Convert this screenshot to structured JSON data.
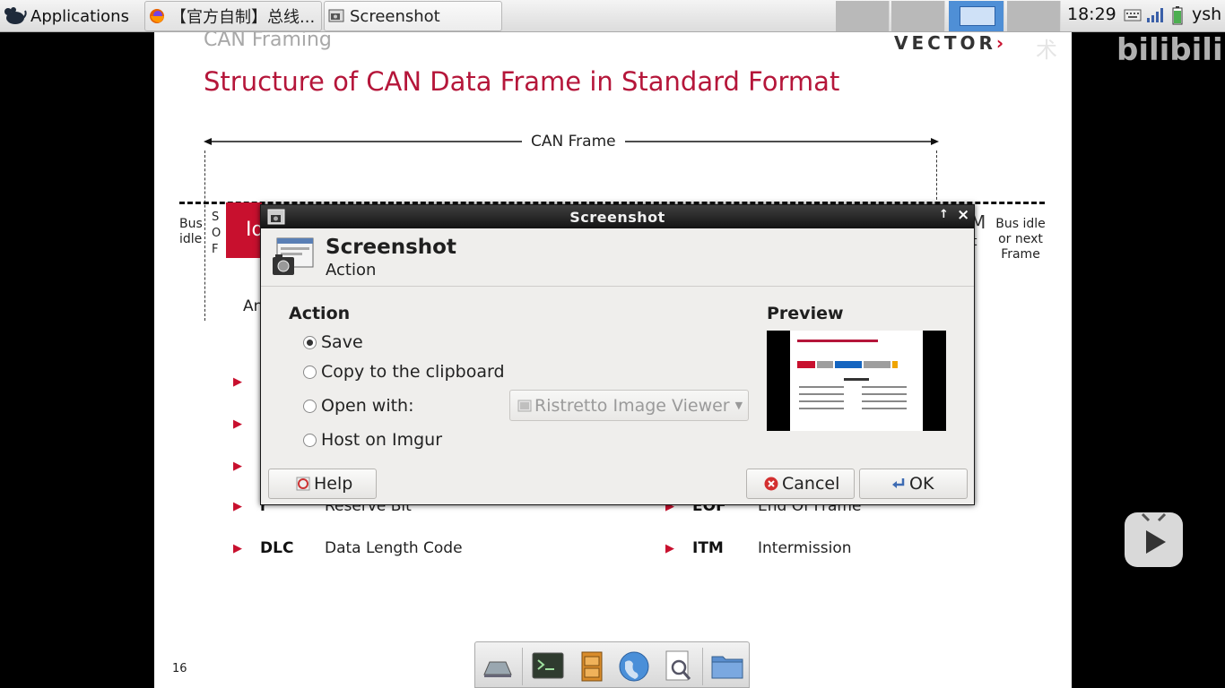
{
  "panel": {
    "apps_label": "Applications",
    "tasks": [
      {
        "label": "【官方自制】总线..."
      },
      {
        "label": "Screenshot"
      }
    ],
    "clock": "18:29",
    "user": "ysh"
  },
  "slide": {
    "header": "CAN Framing",
    "vector_logo": "VECTOR",
    "title": "Structure of CAN Data Frame in Standard Format",
    "frame_label": "CAN Frame",
    "bus_idle_left": "Bus idle",
    "sof_letters": "S O F",
    "id_field_partial": "Id",
    "bus_idle_right": "Bus idle or next Frame",
    "partial_an": "An",
    "partial_m": "M",
    "partial_t": "t",
    "rows": [
      {
        "abbr": "r",
        "desc": "Reserve Bit",
        "abbr2": "EOF",
        "desc2": "End Of Frame"
      },
      {
        "abbr": "DLC",
        "desc": "Data Length Code",
        "abbr2": "ITM",
        "desc2": "Intermission"
      }
    ],
    "page_number": "16"
  },
  "overlay": {
    "bili_text": "术",
    "bili_logo": "bilibili"
  },
  "dialog": {
    "window_title": "Screenshot",
    "header_title": "Screenshot",
    "header_subtitle": "Action",
    "action_heading": "Action",
    "options": {
      "save": "Save",
      "clipboard": "Copy to the clipboard",
      "open_with": "Open with:",
      "imgur": "Host on Imgur"
    },
    "selected_option": "save",
    "open_with_app": "Ristretto Image Viewer",
    "preview_heading": "Preview",
    "buttons": {
      "help": "Help",
      "cancel": "Cancel",
      "ok": "OK"
    }
  },
  "dock": {
    "items": [
      "show-desktop-icon",
      "terminal-icon",
      "file-cabinet-icon",
      "web-browser-icon",
      "image-viewer-icon",
      "folder-icon"
    ]
  },
  "colors": {
    "slide_title": "#b5163a",
    "vector_red": "#c8102e",
    "workspace_active": "#4f8fd6",
    "titlebar": "#141414"
  }
}
